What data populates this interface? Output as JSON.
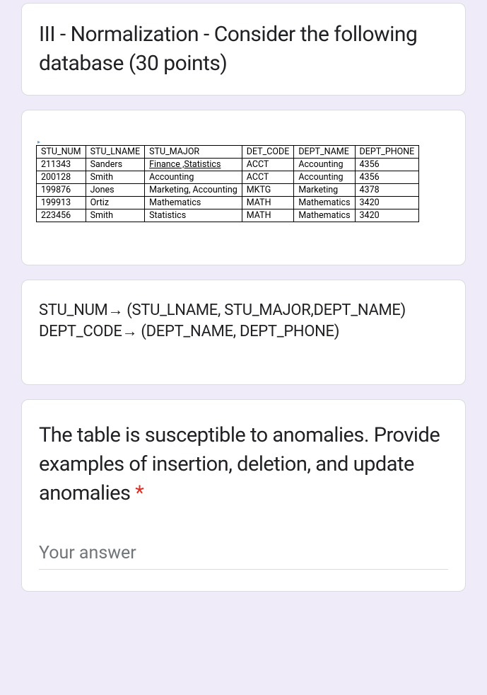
{
  "section": {
    "title": "III - Normalization - Consider the following database (30 points)"
  },
  "table": {
    "headers": {
      "stu_num": "STU_NUM",
      "stu_lname": "STU_LNAME",
      "stu_major": "STU_MAJOR",
      "det_code": "DET_CODE",
      "dept_name": "DEPT_NAME",
      "dept_phone": "DEPT_PHONE"
    },
    "rows": [
      {
        "stu_num": "211343",
        "stu_lname": "Sanders",
        "stu_major": "Finance ,Statistics",
        "det_code": "ACCT",
        "dept_name": "Accounting",
        "dept_phone": "4356",
        "underline": true
      },
      {
        "stu_num": "200128",
        "stu_lname": "Smith",
        "stu_major": "Accounting",
        "det_code": "ACCT",
        "dept_name": "Accounting",
        "dept_phone": "4356",
        "underline": false
      },
      {
        "stu_num": "199876",
        "stu_lname": "Jones",
        "stu_major": "Marketing, Accounting",
        "det_code": "MKTG",
        "dept_name": "Marketing",
        "dept_phone": "4378",
        "underline": false
      },
      {
        "stu_num": "199913",
        "stu_lname": "Ortiz",
        "stu_major": "Mathematics",
        "det_code": "MATH",
        "dept_name": "Mathematics",
        "dept_phone": "3420",
        "underline": false
      },
      {
        "stu_num": "223456",
        "stu_lname": "Smith",
        "stu_major": "Statistics",
        "det_code": "MATH",
        "dept_name": "Mathematics",
        "dept_phone": "3420",
        "underline": false
      }
    ]
  },
  "fd": {
    "line1": "STU_NUM→ (STU_LNAME, STU_MAJOR,DEPT_NAME)",
    "line2": "DEPT_CODE→ (DEPT_NAME, DEPT_PHONE)"
  },
  "question": {
    "text": "The table is susceptible to anomalies. Provide examples of insertion, deletion, and update anomalies ",
    "required": "*",
    "placeholder": "Your answer"
  }
}
